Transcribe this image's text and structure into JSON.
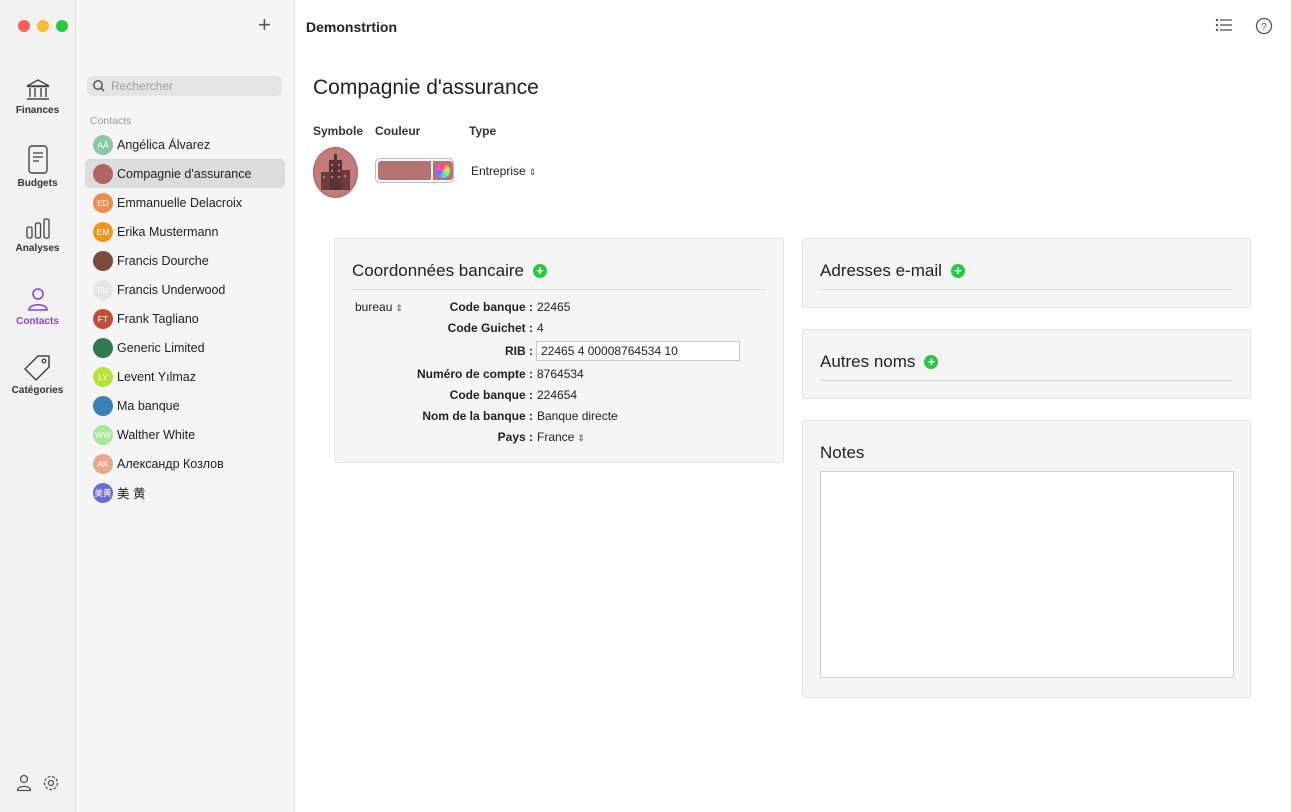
{
  "window": {
    "traffic_colors": [
      "#ff5f57",
      "#febc2e",
      "#28c840"
    ]
  },
  "rail": {
    "items": [
      {
        "label": "Finances",
        "icon": "bank-icon"
      },
      {
        "label": "Budgets",
        "icon": "document-icon"
      },
      {
        "label": "Analyses",
        "icon": "bar-chart-icon"
      },
      {
        "label": "Contacts",
        "icon": "person-icon",
        "active": true
      },
      {
        "label": "Catégories",
        "icon": "tag-icon"
      }
    ],
    "accent": "#8d3fd8"
  },
  "sidebar": {
    "search_placeholder": "Rechercher",
    "section_label": "Contacts",
    "contacts": [
      {
        "name": "Angélica Álvarez",
        "initials": "AÁ",
        "color": "#8fc4a5"
      },
      {
        "name": "Compagnie d'assurance",
        "initials": "",
        "color": "#b06464",
        "selected": true
      },
      {
        "name": "Emmanuelle Delacroix",
        "initials": "ED",
        "color": "#f08b4e"
      },
      {
        "name": "Erika Mustermann",
        "initials": "EM",
        "color": "#f0961e"
      },
      {
        "name": "Francis Dourche",
        "initials": "",
        "color": "#7a4a3a"
      },
      {
        "name": "Francis Underwood",
        "initials": "FU",
        "color": "#e6e6e6"
      },
      {
        "name": "Frank Tagliano",
        "initials": "FT",
        "color": "#c0503a"
      },
      {
        "name": "Generic Limited",
        "initials": "",
        "color": "#2f7a4e"
      },
      {
        "name": "Levent Yılmaz",
        "initials": "LY",
        "color": "#b7e23a"
      },
      {
        "name": "Ma banque",
        "initials": "",
        "color": "#3a7fb7"
      },
      {
        "name": "Walther White",
        "initials": "WW",
        "color": "#a4e89a"
      },
      {
        "name": "Александр Козлов",
        "initials": "AK",
        "color": "#e8a88a"
      },
      {
        "name": "美 黄",
        "initials": "美黄",
        "color": "#6b6bd6"
      }
    ]
  },
  "header": {
    "doc_title": "Demonstrtion"
  },
  "detail": {
    "title": "Compagnie d'assurance",
    "symbol_label": "Symbole",
    "color_label": "Couleur",
    "type_label": "Type",
    "type_value": "Entreprise",
    "color_value": "#b57474"
  },
  "bank": {
    "title": "Coordonnées bancaire",
    "account_type": "bureau",
    "rows": [
      {
        "label": "Code banque :",
        "value": "22465"
      },
      {
        "label": "Code Guichet :",
        "value": "4"
      },
      {
        "label": "RIB :",
        "value": "22465 4 00008764534 10"
      },
      {
        "label": "Numéro de compte :",
        "value": "8764534"
      },
      {
        "label": "Code banque :",
        "value": "224654"
      },
      {
        "label": "Nom de la banque :",
        "value": "Banque directe"
      },
      {
        "label": "Pays :",
        "value": "France"
      }
    ]
  },
  "emails": {
    "title": "Adresses e-mail"
  },
  "other_names": {
    "title": "Autres noms"
  },
  "notes": {
    "title": "Notes",
    "value": ""
  }
}
